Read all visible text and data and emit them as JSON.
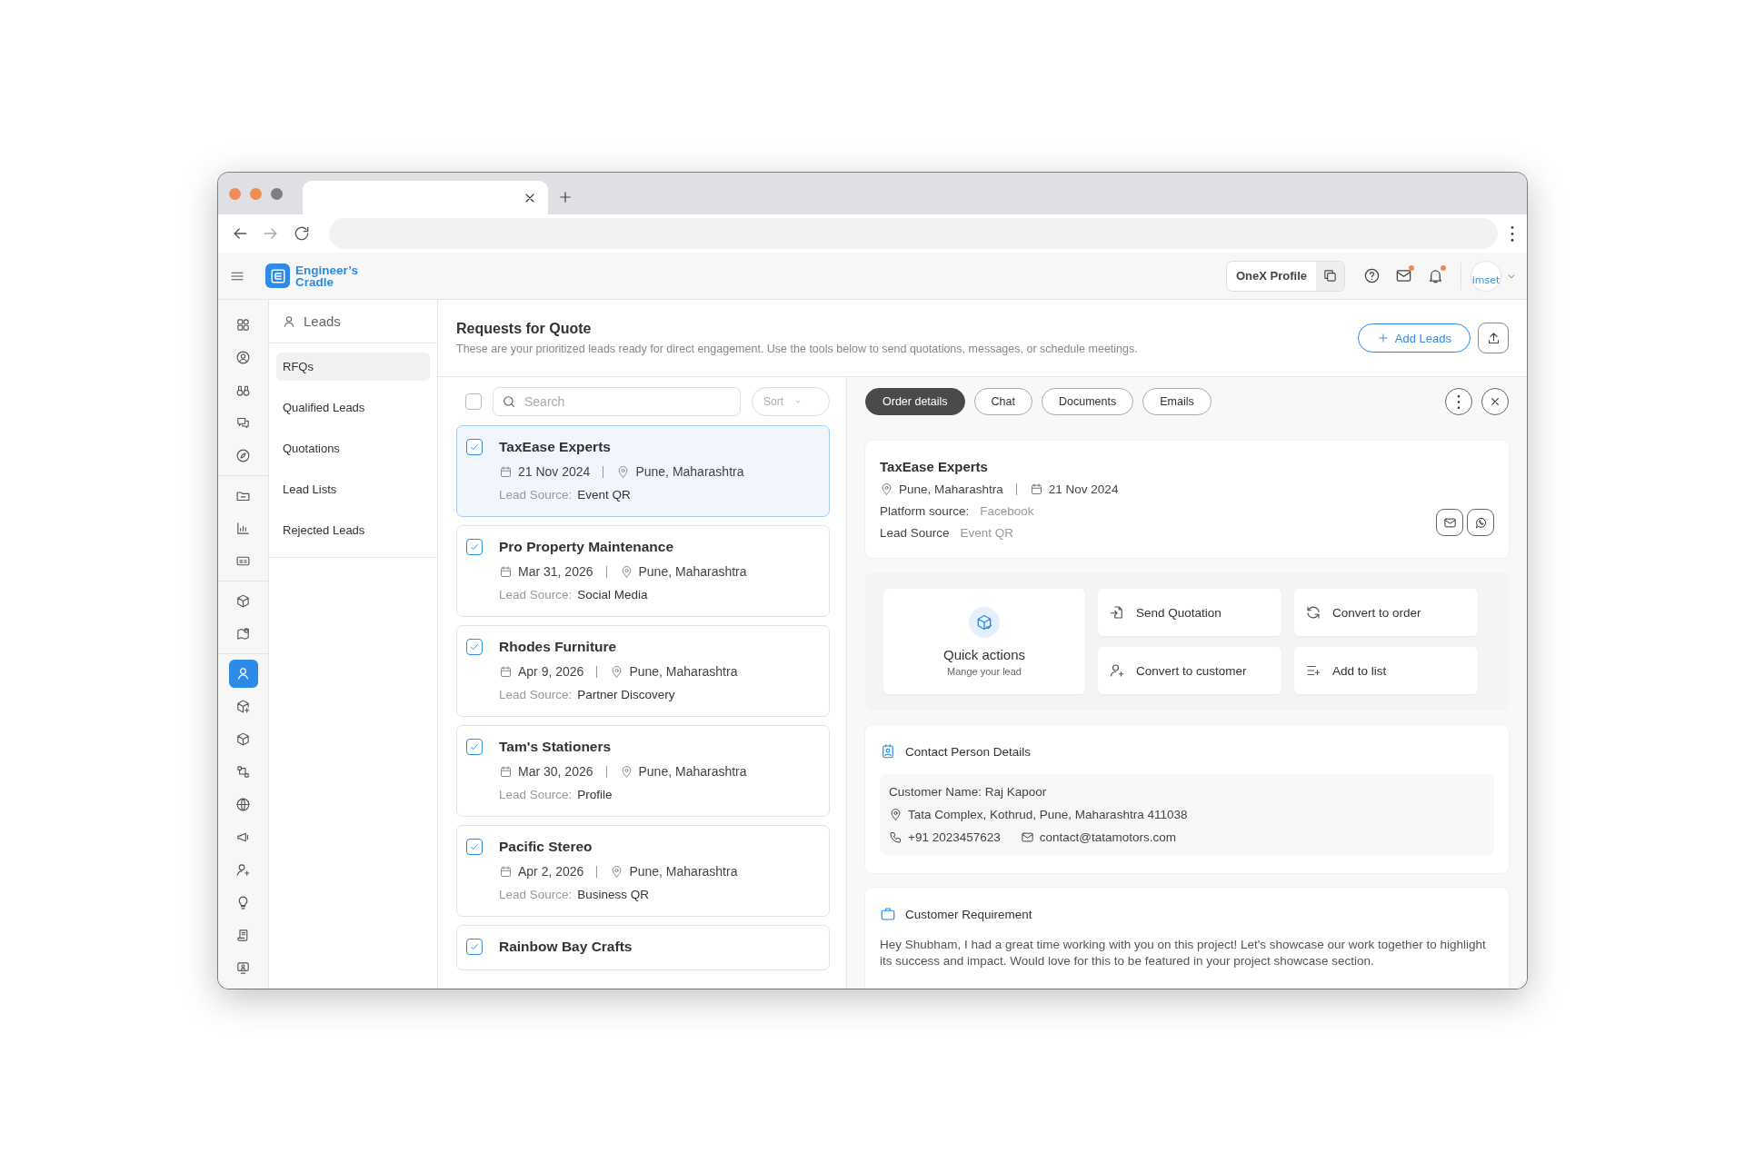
{
  "app": {
    "logo_lines": [
      "Engineer’s",
      "Cradle"
    ],
    "profile_button": "OneX Profile",
    "avatar_text": "imset",
    "mail_unread": true,
    "bell_unread": true
  },
  "rail_groups": [
    [
      {
        "selected": false
      },
      {
        "selected": false
      },
      {
        "selected": false
      },
      {
        "selected": false
      },
      {
        "selected": false
      }
    ],
    [
      {
        "selected": false
      },
      {
        "selected": false
      },
      {
        "selected": false
      }
    ],
    [
      {
        "selected": false
      },
      {
        "selected": false
      }
    ],
    [
      {
        "selected": true
      },
      {
        "selected": false
      },
      {
        "selected": false
      },
      {
        "selected": false
      },
      {
        "selected": false
      },
      {
        "selected": false
      },
      {
        "selected": false
      },
      {
        "selected": false
      },
      {
        "selected": false
      },
      {
        "selected": false
      }
    ]
  ],
  "subnav": {
    "title": "Leads",
    "items": [
      {
        "label": "RFQs",
        "selected": true
      },
      {
        "label": "Qualified Leads",
        "selected": false
      },
      {
        "label": "Quotations",
        "selected": false
      },
      {
        "label": "Lead Lists",
        "selected": false
      },
      {
        "label": "Rejected Leads",
        "selected": false
      }
    ]
  },
  "page": {
    "title": "Requests for Quote",
    "subtitle": "These are your prioritized leads ready for direct engagement. Use the tools below to send quotations, messages, or schedule meetings.",
    "add_button": "Add Leads"
  },
  "list": {
    "select_all_checked": false,
    "search_placeholder": "Search",
    "sort_placeholder": "Sort",
    "leads": [
      {
        "name": "TaxEase Experts",
        "date": "21 Nov 2024",
        "location": "Pune, Maharashtra",
        "source_label": "Lead Source:",
        "source": "Event QR",
        "checked": true,
        "selected": true
      },
      {
        "name": "Pro Property Maintenance",
        "date": "Mar 31, 2026",
        "location": "Pune, Maharashtra",
        "source_label": "Lead Source:",
        "source": "Social Media",
        "checked": true,
        "selected": false
      },
      {
        "name": "Rhodes Furniture",
        "date": "Apr 9, 2026",
        "location": "Pune, Maharashtra",
        "source_label": "Lead Source:",
        "source": "Partner Discovery",
        "checked": true,
        "selected": false
      },
      {
        "name": "Tam's Stationers",
        "date": "Mar 30, 2026",
        "location": "Pune, Maharashtra",
        "source_label": "Lead Source:",
        "source": "Profile",
        "checked": true,
        "selected": false
      },
      {
        "name": "Pacific Stereo",
        "date": "Apr 2, 2026",
        "location": "Pune, Maharashtra",
        "source_label": "Lead Source:",
        "source": "Business QR",
        "checked": true,
        "selected": false
      },
      {
        "name": "Rainbow Bay Crafts",
        "checked": true,
        "selected": false
      }
    ]
  },
  "detail": {
    "tabs": [
      {
        "label": "Order details",
        "selected": true
      },
      {
        "label": "Chat",
        "selected": false
      },
      {
        "label": "Documents",
        "selected": false
      },
      {
        "label": "Emails",
        "selected": false
      }
    ],
    "card": {
      "name": "TaxEase Experts",
      "location": "Pune, Maharashtra",
      "date": "21 Nov 2024",
      "platform_label": "Platform source:",
      "platform": "Facebook",
      "source_label": "Lead Source",
      "source": "Event QR"
    },
    "quick": {
      "title": "Quick actions",
      "subtitle": "Mange your lead",
      "actions": [
        {
          "label": "Send Quotation"
        },
        {
          "label": "Convert to order"
        },
        {
          "label": "Convert to customer"
        },
        {
          "label": "Add to list"
        }
      ]
    },
    "contact": {
      "title": "Contact Person Details",
      "name_line": "Customer Name: Raj Kapoor",
      "address": "Tata Complex, Kothrud, Pune, Maharashtra 411038",
      "phone": "+91 2023457623",
      "email": "contact@tatamotors.com"
    },
    "requirement": {
      "title": "Customer Requirement",
      "text": "Hey Shubham, I had a great time working with you on this project! Let's showcase our work together to highlight its success and impact. Would love for this to be featured in your project showcase section."
    }
  }
}
